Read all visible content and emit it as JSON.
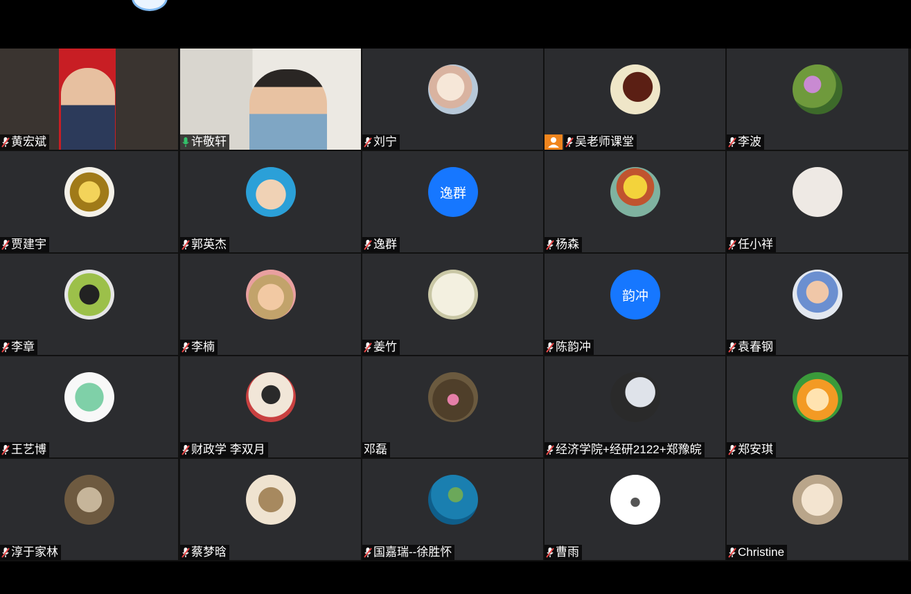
{
  "colors": {
    "tile_bg": "#2b2c2f",
    "active_border": "#2fae6c",
    "text_avatar_bg": "#1677ff",
    "host_badge": "#f0851e",
    "mic_muted": "#e64545",
    "mic_active": "#33c36b"
  },
  "participants": [
    {
      "name": "黄宏斌",
      "mic": "muted",
      "video": true
    },
    {
      "name": "许敬轩",
      "mic": "active",
      "video": true,
      "speaking": true
    },
    {
      "name": "刘宁",
      "mic": "muted",
      "avatar": "cartoon-bunny-avatar"
    },
    {
      "name": "吴老师课堂",
      "mic": "muted",
      "avatar": "glasses-man-sketch-avatar",
      "host": true
    },
    {
      "name": "李波",
      "mic": "muted",
      "avatar": "flowers-avatar"
    },
    {
      "name": "贾建宇",
      "mic": "muted",
      "avatar": "gold-gear-avatar"
    },
    {
      "name": "郭英杰",
      "mic": "muted",
      "avatar": "bald-cartoon-avatar"
    },
    {
      "name": "逸群",
      "mic": "muted",
      "avatar_text": "逸群"
    },
    {
      "name": "杨森",
      "mic": "muted",
      "avatar": "cartoon-boy-avatar"
    },
    {
      "name": "任小祥",
      "mic": "muted",
      "avatar": "doodle-avatar"
    },
    {
      "name": "李章",
      "mic": "muted",
      "avatar": "person-outdoor-avatar"
    },
    {
      "name": "李楠",
      "mic": "muted",
      "avatar": "child-hat-avatar"
    },
    {
      "name": "姜竹",
      "mic": "muted",
      "avatar": "bamboo-avatar"
    },
    {
      "name": "陈韵冲",
      "mic": "muted",
      "avatar_text": "韵冲"
    },
    {
      "name": "袁春钢",
      "mic": "muted",
      "avatar": "cartoon-man-avatar"
    },
    {
      "name": "王艺博",
      "mic": "muted",
      "avatar": "green-dino-avatar"
    },
    {
      "name": "财政学 李双月",
      "mic": "muted",
      "avatar": "anime-girl-avatar"
    },
    {
      "name": "邓磊",
      "mic": "none",
      "avatar": "bowl-food-avatar"
    },
    {
      "name": "经济学院+经研2122+郑豫皖",
      "mic": "muted",
      "avatar": "face-closeup-avatar"
    },
    {
      "name": "郑安琪",
      "mic": "muted",
      "avatar": "cartoon-lion-avatar"
    },
    {
      "name": "淳于家林",
      "mic": "muted",
      "avatar": "child-photo-avatar"
    },
    {
      "name": "蔡梦晗",
      "mic": "muted",
      "avatar": "drawing-girl-avatar"
    },
    {
      "name": "国嘉瑞--徐胜怀",
      "mic": "muted",
      "avatar": "island-sea-avatar"
    },
    {
      "name": "曹雨",
      "mic": "muted",
      "avatar": "small-figure-avatar"
    },
    {
      "name": "Christine",
      "mic": "muted",
      "avatar": "teddy-bear-avatar"
    }
  ]
}
